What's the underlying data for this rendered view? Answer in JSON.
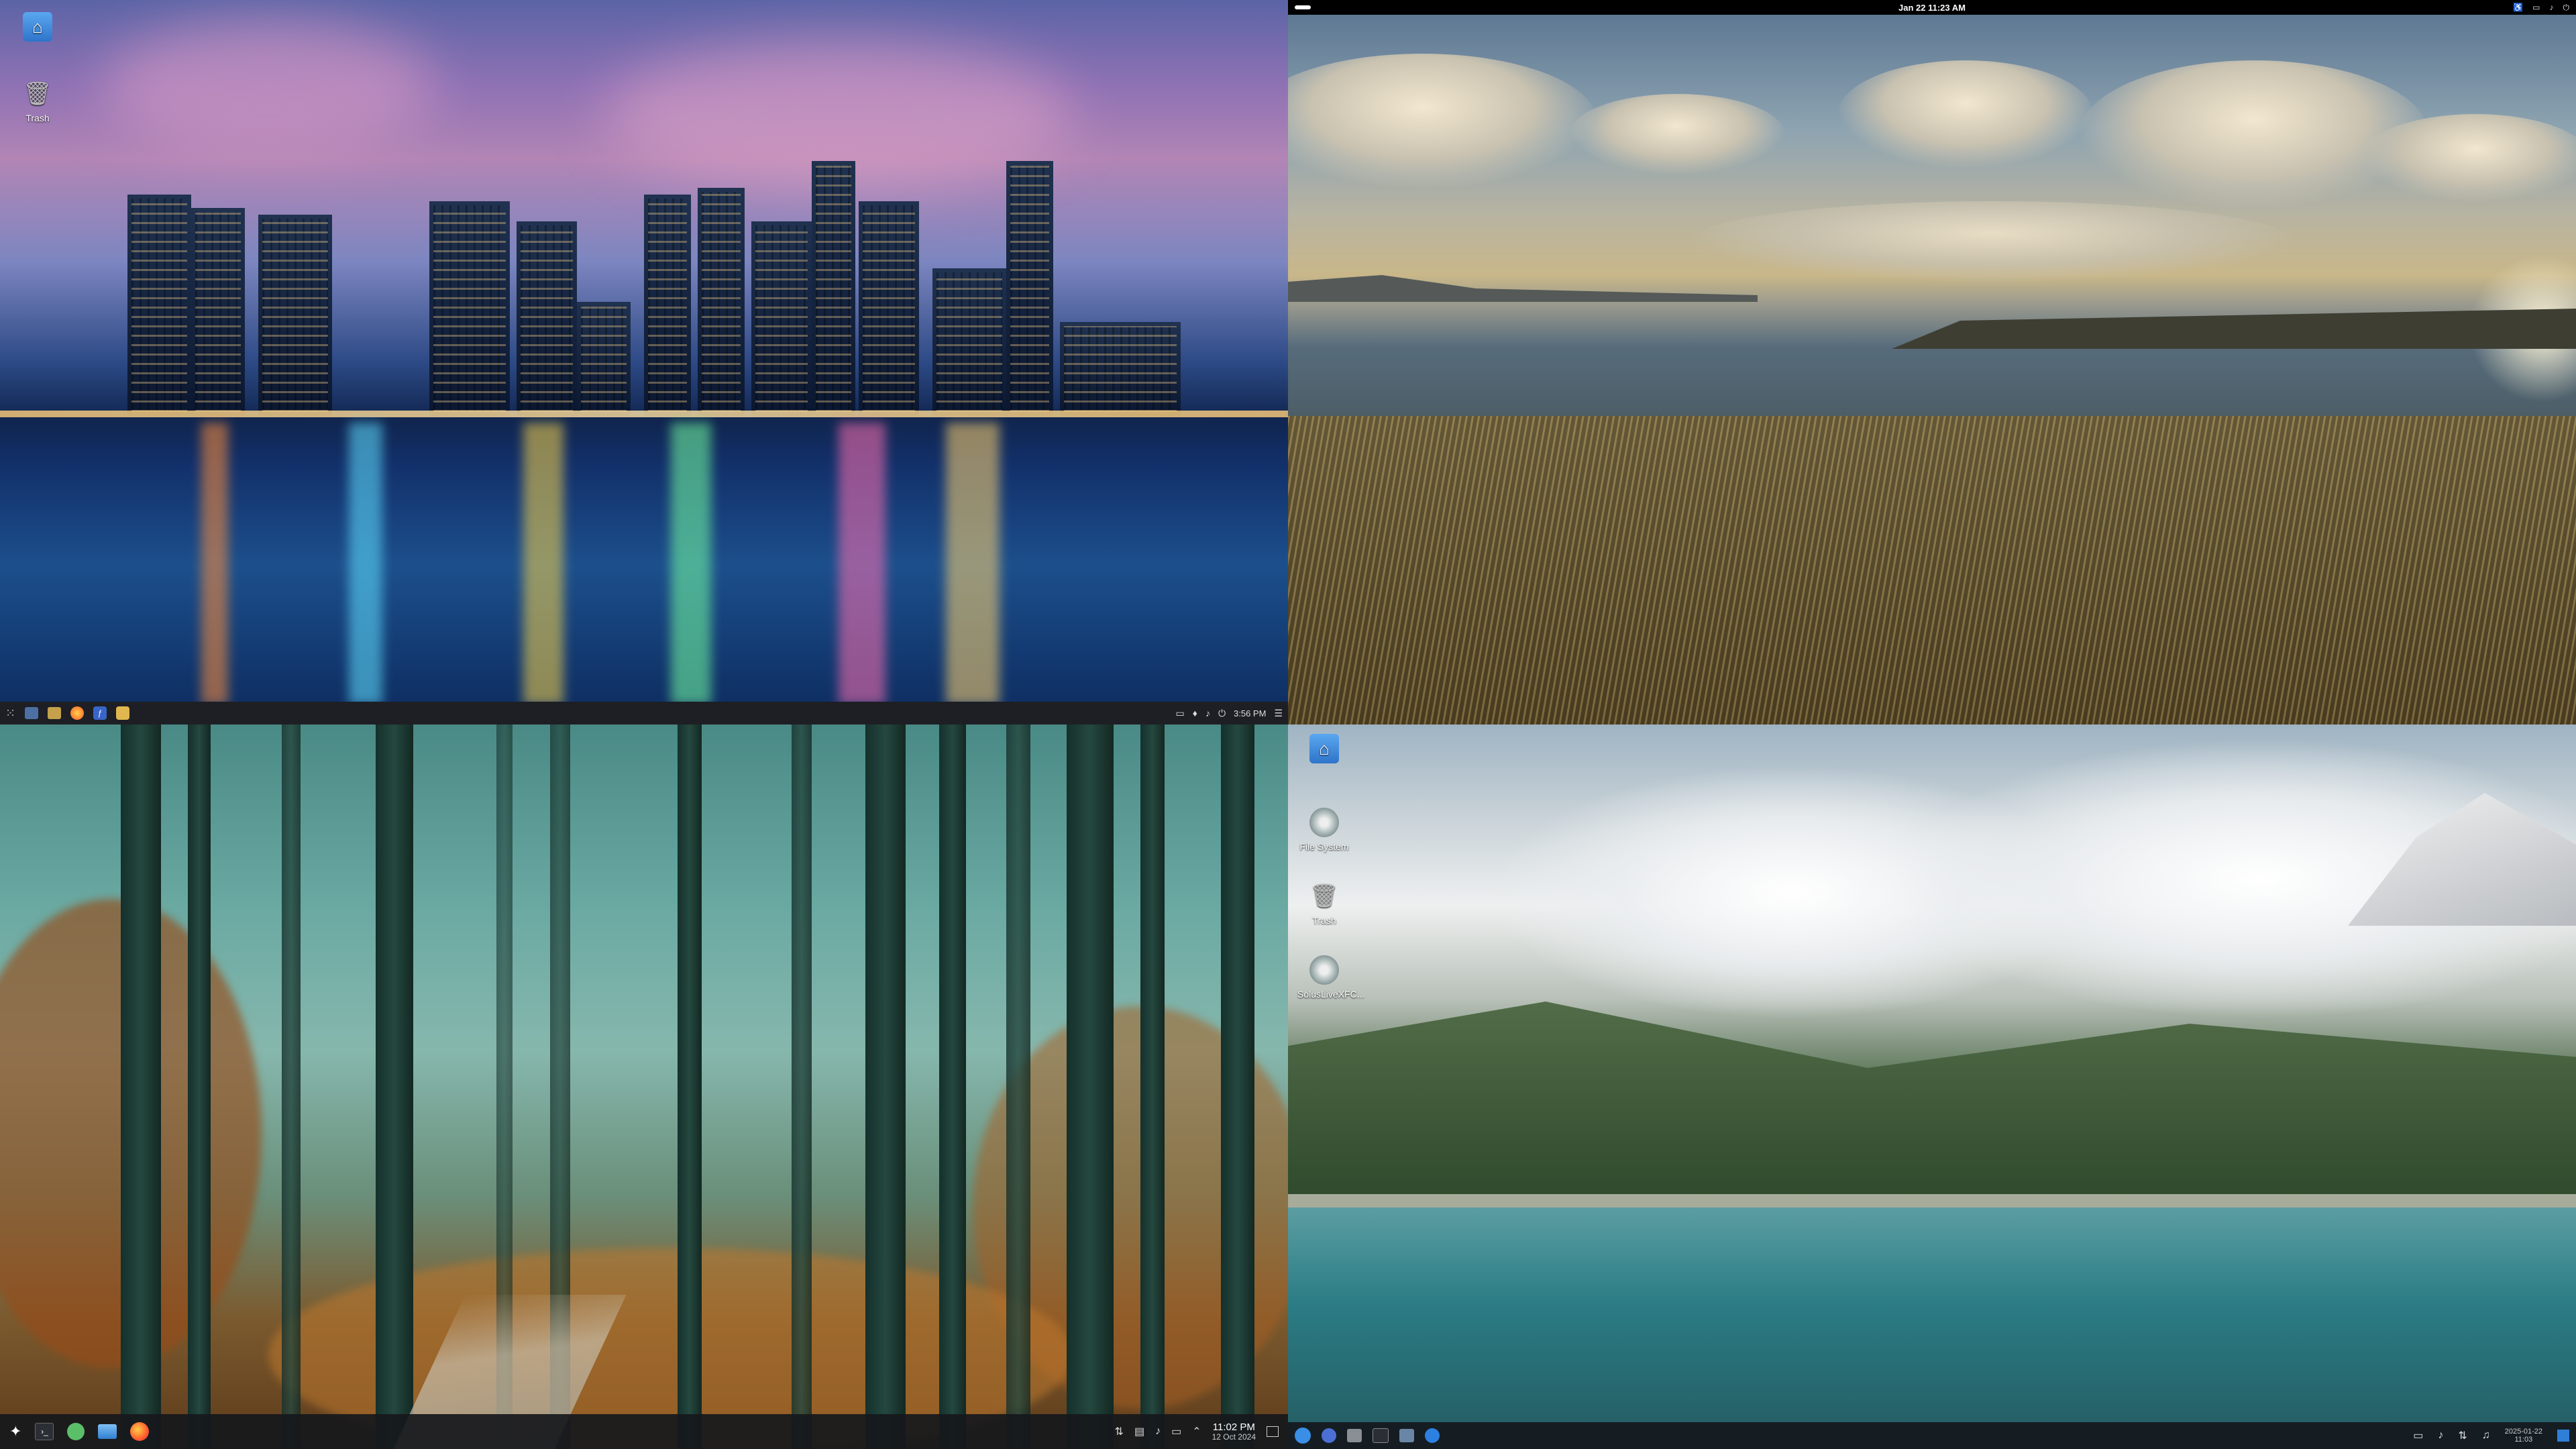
{
  "top_left": {
    "desktop_icons": [
      {
        "label": "",
        "icon": "home-folder-icon"
      },
      {
        "label": "Trash",
        "icon": "trash-icon"
      }
    ],
    "panel": {
      "launchers": [
        "app-grid-icon",
        "desktop-icon",
        "files-icon",
        "firefox-icon",
        "fedora-icon",
        "settings-icon"
      ],
      "tray_icons": [
        "screen-icon",
        "notification-icon",
        "volume-icon",
        "power-icon"
      ],
      "clock": "3:56 PM"
    }
  },
  "top_right": {
    "top_bar": {
      "activities": "",
      "clock": "Jan 22  11:23 AM",
      "tray_icons": [
        "accessibility-icon",
        "screen-icon",
        "volume-icon",
        "power-icon"
      ]
    }
  },
  "bottom_left": {
    "panel": {
      "launchers": [
        "menu-icon",
        "terminal-icon",
        "app-icon",
        "files-icon",
        "firefox-icon"
      ],
      "tray_icons": [
        "network-icon",
        "clipboard-icon",
        "volume-icon",
        "display-icon",
        "expand-icon"
      ],
      "time": "11:02 PM",
      "date": "12 Oct 2024"
    }
  },
  "bottom_right": {
    "desktop_icons": [
      {
        "label": "",
        "icon": "home-folder-icon"
      },
      {
        "label": "File System",
        "icon": "filesystem-icon"
      },
      {
        "label": "Trash",
        "icon": "trash-icon"
      },
      {
        "label": "SolusLiveXFC...",
        "icon": "disk-icon"
      }
    ],
    "panel": {
      "launchers": [
        "menu-icon",
        "app-icon",
        "files-icon",
        "terminal-icon",
        "installer-icon",
        "settings-icon"
      ],
      "tray_icons": [
        "display-icon",
        "volume-icon",
        "network-icon",
        "bell-icon"
      ],
      "date": "2025-01-22",
      "time": "11:03"
    }
  }
}
